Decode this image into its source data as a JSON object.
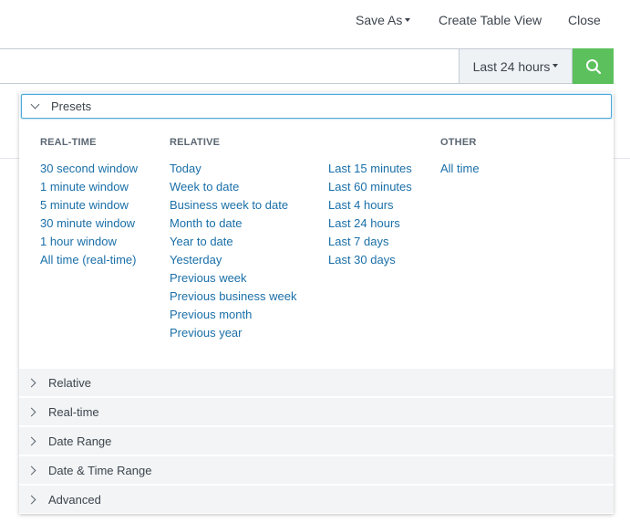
{
  "topbar": {
    "save_as": "Save As",
    "create_table_view": "Create Table View",
    "close": "Close"
  },
  "search": {
    "value": "",
    "time_range": "Last 24 hours"
  },
  "dropdown": {
    "presets_label": "Presets",
    "columns": {
      "realtime": {
        "title": "REAL-TIME",
        "items": [
          "30 second window",
          "1 minute window",
          "5 minute window",
          "30 minute window",
          "1 hour window",
          "All time (real-time)"
        ]
      },
      "relative": {
        "title": "RELATIVE",
        "items": [
          "Today",
          "Week to date",
          "Business week to date",
          "Month to date",
          "Year to date",
          "Yesterday",
          "Previous week",
          "Previous business week",
          "Previous month",
          "Previous year"
        ]
      },
      "relative2": {
        "items": [
          "Last 15 minutes",
          "Last 60 minutes",
          "Last 4 hours",
          "Last 24 hours",
          "Last 7 days",
          "Last 30 days"
        ]
      },
      "other": {
        "title": "OTHER",
        "items": [
          "All time"
        ]
      }
    },
    "sections": [
      "Relative",
      "Real-time",
      "Date Range",
      "Date & Time Range",
      "Advanced"
    ]
  },
  "colors": {
    "link": "#1a6fa8",
    "search_button": "#5cc05c",
    "focus_border": "#4fa8d8"
  }
}
